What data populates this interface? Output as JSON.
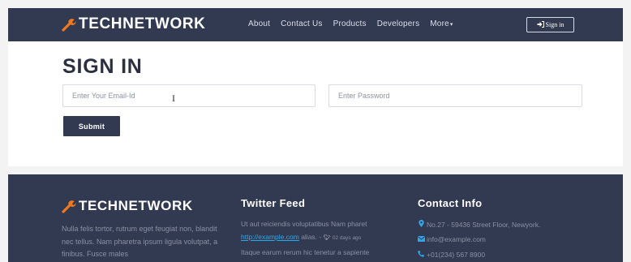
{
  "brand": {
    "name": "TECHNETWORK",
    "accent_color": "#f0791f",
    "nav_bg": "#323a52"
  },
  "nav": {
    "items": [
      {
        "label": "About"
      },
      {
        "label": "Contact Us"
      },
      {
        "label": "Products"
      },
      {
        "label": "Developers"
      },
      {
        "label": "More"
      }
    ],
    "more_caret": "▾",
    "signin_icon": "sign-in-icon",
    "signin_label": "Sign in"
  },
  "signin_form": {
    "title": "SIGN IN",
    "email_placeholder": "Enter Your Email-Id",
    "password_placeholder": "Enter Password",
    "submit_label": "Submit"
  },
  "footer": {
    "brand_name": "TECHNETWORK",
    "about_text": "Nulla felis tortor, rutrum eget feugiat non, blandit nec tellus. Nam pharetra ipsum ligula volutpat, a finibus. Fusce males",
    "twitter": {
      "title": "Twitter Feed",
      "tweets": [
        {
          "text": "Ut aut reiciendis voluptatibus Nam pharet",
          "link": "http://example.com",
          "suffix": "alias. -",
          "time": "02 days ago"
        },
        {
          "text": "Itaque earum rerum hic tenetur a sapiente"
        }
      ]
    },
    "contact": {
      "title": "Contact Info",
      "address": "No.27 - 59436 Street Floor, Newyork.",
      "email": "info@example.com",
      "phone": "+01(234) 567 8900"
    }
  }
}
